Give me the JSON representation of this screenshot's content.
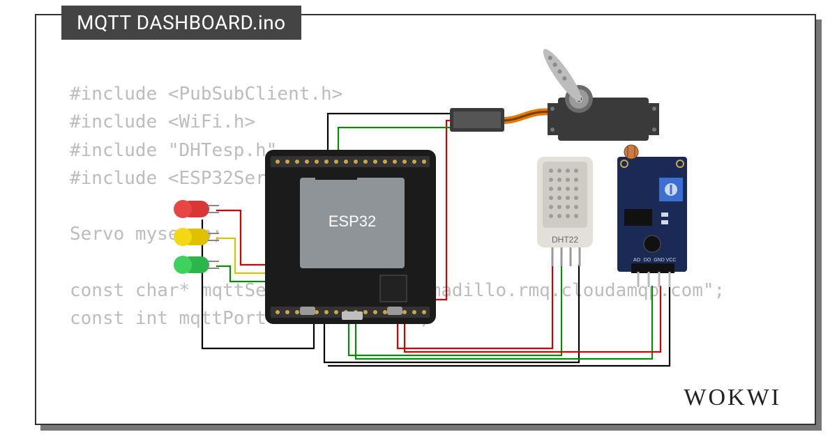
{
  "title": "MQTT DASHBOARD.ino",
  "brand": "WOKWI",
  "chip_label": "ESP32",
  "dht_label": "DHT22",
  "code_lines": [
    "#include <PubSubClient.h>",
    "#include <WiFi.h>",
    "#include \"DHTesp.h\"",
    "#include <ESP32Servo.h>",
    "",
    "Servo myservo;",
    "",
    "const char* mqttServer      = \"armadillo.rmq.cloudamqp.com\";",
    "const int mqttPort        = 1883;"
  ],
  "components": {
    "board": "ESP32 DevKit",
    "sensors": [
      "DHT22",
      "LDR light sensor module"
    ],
    "actuators": [
      "Servo motor",
      "Red LED",
      "Yellow LED",
      "Green LED"
    ]
  },
  "wire_colors": {
    "power": "#d40000",
    "ground": "#000000",
    "signal": "#0a8a0a",
    "led_red": "#d40000",
    "led_yellow": "#d6c400",
    "led_green": "#0a8a0a"
  }
}
